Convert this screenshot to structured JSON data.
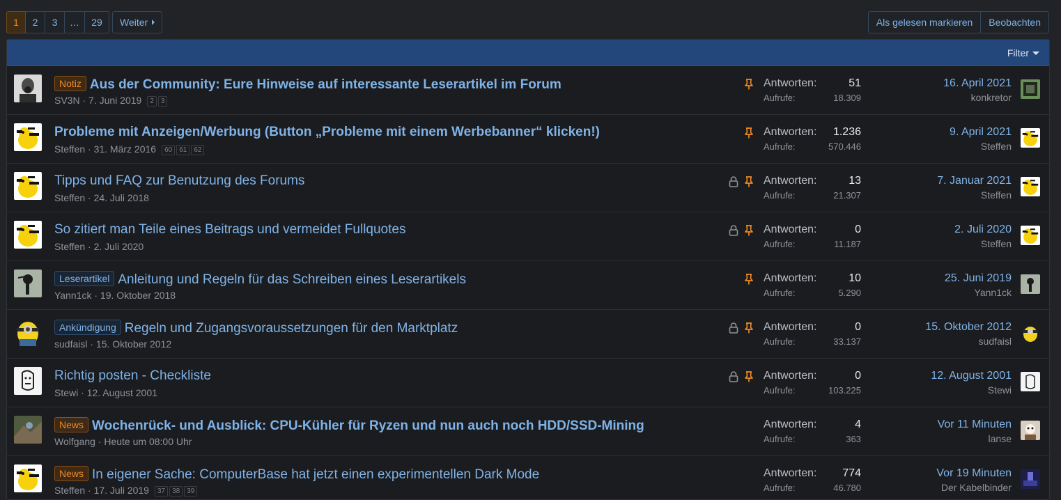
{
  "pagination": {
    "pages": [
      "1",
      "2",
      "3",
      "…",
      "29"
    ],
    "current": "1",
    "next_label": "Weiter"
  },
  "actions": {
    "mark_read": "Als gelesen markieren",
    "watch": "Beobachten"
  },
  "filter_label": "Filter",
  "labels": {
    "replies": "Antworten:",
    "views": "Aufrufe:"
  },
  "threads": [
    {
      "prefix": "Notiz",
      "prefix_style": "orange",
      "title": "Aus der Community: Eure Hinweise auf interessante Leserartikel im Forum",
      "bold": true,
      "author": "SV3N",
      "date": "7. Juni 2019",
      "pages": [
        "2",
        "3"
      ],
      "locked": false,
      "sticky": true,
      "replies": "51",
      "views": "18.309",
      "last_date": "16. April 2021",
      "last_user": "konkretor"
    },
    {
      "prefix": "",
      "prefix_style": "",
      "title": "Probleme mit Anzeigen/Werbung (Button „Probleme mit einem Werbebanner“ klicken!)",
      "bold": true,
      "author": "Steffen",
      "date": "31. März 2016",
      "pages": [
        "60",
        "61",
        "62"
      ],
      "locked": false,
      "sticky": true,
      "replies": "1.236",
      "views": "570.446",
      "last_date": "9. April 2021",
      "last_user": "Steffen"
    },
    {
      "prefix": "",
      "prefix_style": "",
      "title": "Tipps und FAQ zur Benutzung des Forums",
      "bold": false,
      "author": "Steffen",
      "date": "24. Juli 2018",
      "pages": [],
      "locked": true,
      "sticky": true,
      "replies": "13",
      "views": "21.307",
      "last_date": "7. Januar 2021",
      "last_user": "Steffen"
    },
    {
      "prefix": "",
      "prefix_style": "",
      "title": "So zitiert man Teile eines Beitrags und vermeidet Fullquotes",
      "bold": false,
      "author": "Steffen",
      "date": "2. Juli 2020",
      "pages": [],
      "locked": true,
      "sticky": true,
      "replies": "0",
      "views": "11.187",
      "last_date": "2. Juli 2020",
      "last_user": "Steffen"
    },
    {
      "prefix": "Leserartikel",
      "prefix_style": "blue",
      "title": "Anleitung und Regeln für das Schreiben eines Leserartikels",
      "bold": false,
      "author": "Yann1ck",
      "date": "19. Oktober 2018",
      "pages": [],
      "locked": false,
      "sticky": true,
      "replies": "10",
      "views": "5.290",
      "last_date": "25. Juni 2019",
      "last_user": "Yann1ck"
    },
    {
      "prefix": "Ankündigung",
      "prefix_style": "blue",
      "title": "Regeln und Zugangsvoraussetzungen für den Marktplatz",
      "bold": false,
      "author": "sudfaisl",
      "date": "15. Oktober 2012",
      "pages": [],
      "locked": true,
      "sticky": true,
      "replies": "0",
      "views": "33.137",
      "last_date": "15. Oktober 2012",
      "last_user": "sudfaisl"
    },
    {
      "prefix": "",
      "prefix_style": "",
      "title": "Richtig posten - Checkliste",
      "bold": false,
      "author": "Stewi",
      "date": "12. August 2001",
      "pages": [],
      "locked": true,
      "sticky": true,
      "replies": "0",
      "views": "103.225",
      "last_date": "12. August 2001",
      "last_user": "Stewi"
    },
    {
      "prefix": "News",
      "prefix_style": "orange",
      "title": "Wochenrück- und Ausblick: CPU-Kühler für Ryzen und nun auch noch HDD/SSD-Mining",
      "bold": true,
      "author": "Wolfgang",
      "date": "Heute um 08:00 Uhr",
      "pages": [],
      "locked": false,
      "sticky": false,
      "replies": "4",
      "views": "363",
      "last_date": "Vor 11 Minuten",
      "last_user": "lanse"
    },
    {
      "prefix": "News",
      "prefix_style": "orange",
      "title": "In eigener Sache: ComputerBase hat jetzt einen experimentellen Dark Mode",
      "bold": false,
      "author": "Steffen",
      "date": "17. Juli 2019",
      "pages": [
        "37",
        "38",
        "39"
      ],
      "locked": false,
      "sticky": false,
      "replies": "774",
      "views": "46.780",
      "last_date": "Vor 19 Minuten",
      "last_user": "Der Kabelbinder"
    }
  ],
  "colors": {
    "accent_link": "#7fb3e8",
    "accent_orange": "#f08a24",
    "filter_bar": "#23477a",
    "background": "#222326"
  },
  "icons": {
    "lock": "lock-icon",
    "pin": "pin-icon"
  }
}
